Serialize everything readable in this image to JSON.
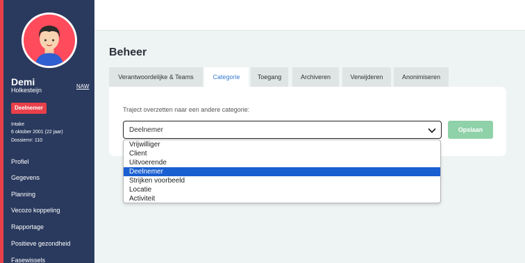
{
  "sidebar": {
    "user": {
      "first_name": "Demi",
      "last_name": "Holkesteijn",
      "naw_link": "NAW",
      "role_badge": "Deelnemer"
    },
    "meta": {
      "intake_label": "Intake",
      "intake_date": "6 oktober 2001 (22 jaar)",
      "dossier": "Dossiernr: 110"
    },
    "nav_items": [
      "Profiel",
      "Gegevens",
      "Planning",
      "Vecozo koppeling",
      "Rapportage",
      "Positieve gezondheid",
      "Fasewissels"
    ],
    "accent_color": "#e8404a",
    "bg_color": "#2a3a5e"
  },
  "main": {
    "page_title": "Beheer",
    "tabs": [
      "Verantwoordelijke & Teams",
      "Categorie",
      "Toegang",
      "Archiveren",
      "Verwijderen",
      "Anonimiseren"
    ],
    "active_tab": "Categorie",
    "form": {
      "label": "Traject overzetten naar een andere categorie:",
      "selected_value": "Deelnemer",
      "options": [
        "Vrijwilliger",
        "Client",
        "Uitvoerende",
        "Deelnemer",
        "Strijken voorbeeld",
        "Locatie",
        "Activiteit"
      ],
      "highlighted_option": "Deelnemer",
      "save_label": "Opslaan",
      "save_color": "#8fd1a8"
    }
  },
  "icons": {
    "avatar": "person-avatar-icon",
    "select_arrow": "chevron-down-icon"
  }
}
